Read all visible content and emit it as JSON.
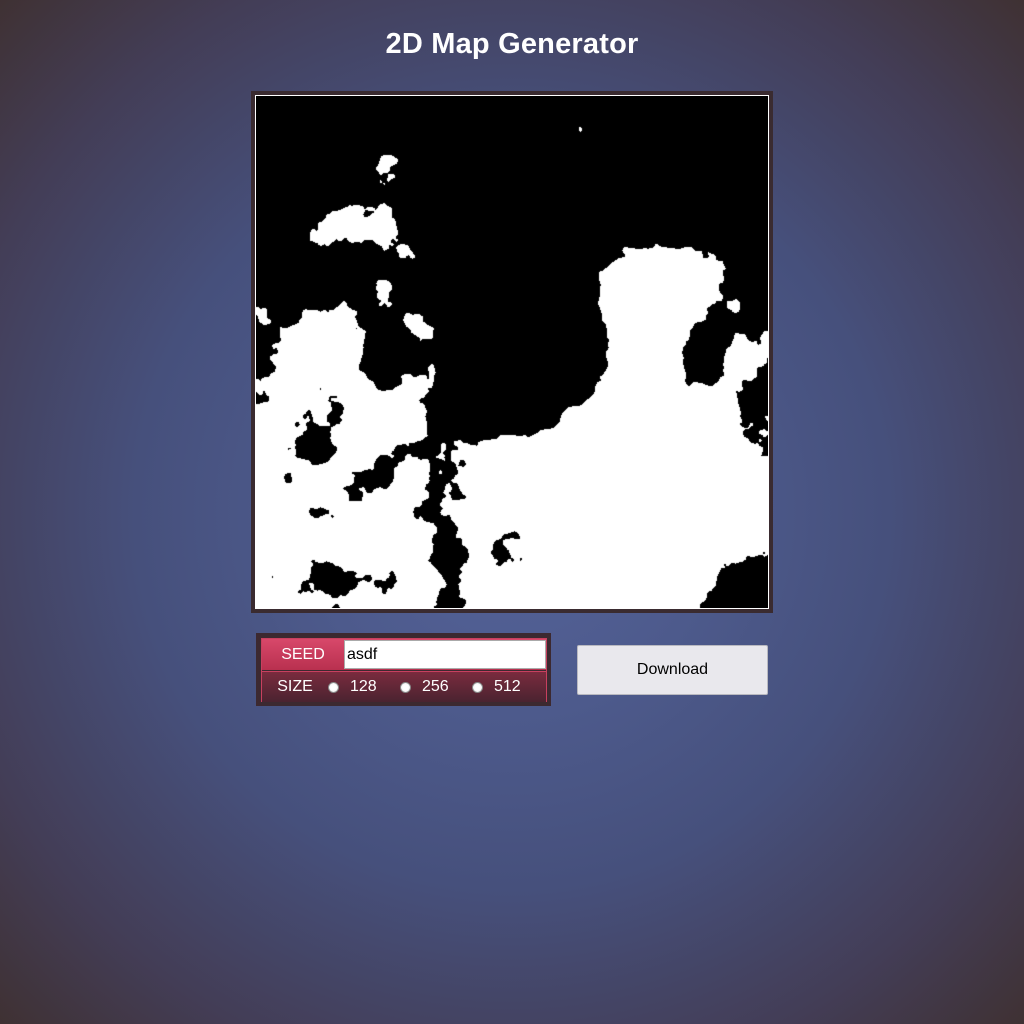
{
  "page": {
    "title": "2D Map Generator"
  },
  "map": {
    "land_color": "#000000",
    "water_color": "#ffffff",
    "frame_color": "#3a2b30"
  },
  "controls": {
    "seed_label": "SEED",
    "seed_value": "asdf",
    "size_label": "SIZE",
    "size_options": [
      "128",
      "256",
      "512"
    ]
  },
  "download": {
    "label": "Download"
  },
  "colors": {
    "accent": "#d8486a",
    "accent_dark": "#4a2330",
    "button_bg": "#e9e8ed"
  }
}
